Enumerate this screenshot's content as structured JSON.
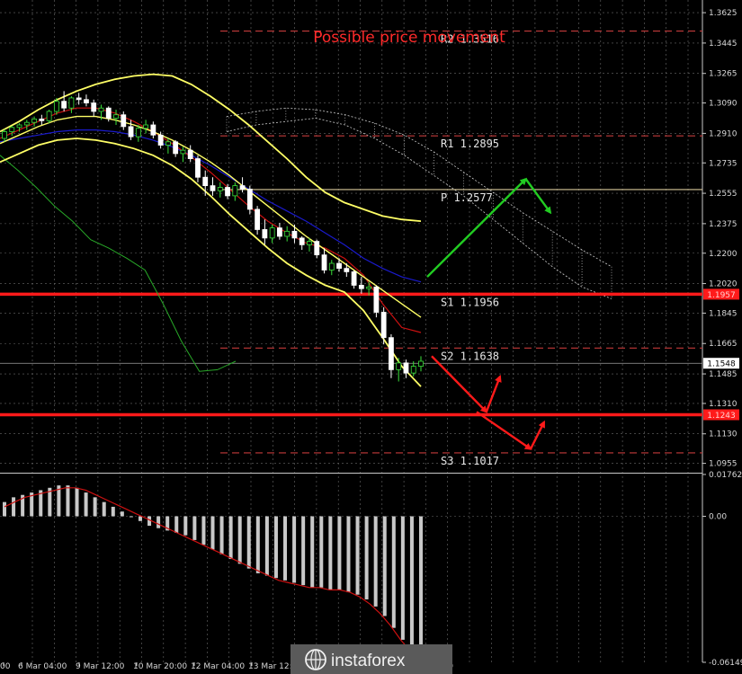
{
  "chart_data": {
    "type": "line",
    "title": "Possible price movement",
    "price_axis": {
      "ticks": [
        "1.3625",
        "1.3445",
        "1.3265",
        "1.3090",
        "1.2910",
        "1.2735",
        "1.2555",
        "1.2375",
        "1.2200",
        "1.2020",
        "1.1845",
        "1.1665",
        "1.1485",
        "1.1310",
        "1.1130",
        "1.0955"
      ],
      "range": [
        1.0905,
        1.37
      ]
    },
    "macd_axis": {
      "ticks": [
        "0.01762",
        "0.00",
        "-0.06149"
      ],
      "range": [
        -0.0615,
        0.0176
      ]
    },
    "time_axis": {
      "ticks": [
        "00",
        "6 Mar 04:00",
        "9 Mar 12:00",
        "10 Mar 20:00",
        "12 Mar 04:00",
        "13 Mar 12:",
        "12:00"
      ]
    },
    "levels": [
      {
        "name": "R2",
        "label": "R2  1.3516",
        "value": 1.3516,
        "color": "#c33a3a",
        "style": "dashed"
      },
      {
        "name": "R1",
        "label": "R1  1.2895",
        "value": 1.2895,
        "color": "#c33a3a",
        "style": "dashed"
      },
      {
        "name": "P",
        "label": "P  1.2577",
        "value": 1.2577,
        "color": "#d8c89a",
        "style": "solid"
      },
      {
        "name": "S1",
        "label": "S1  1.1956",
        "value": 1.1956,
        "color": "#c33a3a",
        "style": "dashed"
      },
      {
        "name": "S2",
        "label": "S2  1.1638",
        "value": 1.1638,
        "color": "#c33a3a",
        "style": "dashed"
      },
      {
        "name": "S3",
        "label": "S3  1.1017",
        "value": 1.1017,
        "color": "#c33a3a",
        "style": "dashed"
      }
    ],
    "support_resistance": [
      {
        "label": "1.1957",
        "value": 1.1957,
        "color": "#ff1a1a"
      },
      {
        "label": "1.1243",
        "value": 1.1243,
        "color": "#ff1a1a"
      }
    ],
    "current_price": {
      "label": "1.1548",
      "value": 1.1548
    },
    "candles": [
      [
        1.288,
        1.2935,
        1.286,
        1.292
      ],
      [
        1.292,
        1.2955,
        1.2895,
        1.2945
      ],
      [
        1.2945,
        1.297,
        1.292,
        1.296
      ],
      [
        1.296,
        1.299,
        1.293,
        1.2975
      ],
      [
        1.2975,
        1.301,
        1.295,
        1.2995
      ],
      [
        1.2995,
        1.302,
        1.296,
        1.2985
      ],
      [
        1.2985,
        1.305,
        1.297,
        1.304
      ],
      [
        1.304,
        1.312,
        1.302,
        1.31
      ],
      [
        1.31,
        1.316,
        1.304,
        1.306
      ],
      [
        1.306,
        1.313,
        1.303,
        1.312
      ],
      [
        1.312,
        1.315,
        1.308,
        1.311
      ],
      [
        1.311,
        1.314,
        1.307,
        1.309
      ],
      [
        1.309,
        1.311,
        1.301,
        1.304
      ],
      [
        1.304,
        1.308,
        1.299,
        1.306
      ],
      [
        1.306,
        1.307,
        1.298,
        1.3
      ],
      [
        1.3,
        1.305,
        1.296,
        1.302
      ],
      [
        1.302,
        1.304,
        1.293,
        1.295
      ],
      [
        1.295,
        1.299,
        1.287,
        1.289
      ],
      [
        1.289,
        1.296,
        1.286,
        1.294
      ],
      [
        1.294,
        1.299,
        1.291,
        1.296
      ],
      [
        1.296,
        1.298,
        1.288,
        1.29
      ],
      [
        1.29,
        1.292,
        1.282,
        1.284
      ],
      [
        1.284,
        1.288,
        1.279,
        1.286
      ],
      [
        1.286,
        1.287,
        1.277,
        1.279
      ],
      [
        1.279,
        1.283,
        1.274,
        1.281
      ],
      [
        1.281,
        1.284,
        1.274,
        1.276
      ],
      [
        1.276,
        1.278,
        1.262,
        1.265
      ],
      [
        1.265,
        1.269,
        1.254,
        1.26
      ],
      [
        1.26,
        1.265,
        1.254,
        1.257
      ],
      [
        1.257,
        1.262,
        1.253,
        1.259
      ],
      [
        1.259,
        1.261,
        1.252,
        1.254
      ],
      [
        1.254,
        1.262,
        1.251,
        1.26
      ],
      [
        1.26,
        1.265,
        1.256,
        1.258
      ],
      [
        1.258,
        1.26,
        1.243,
        1.246
      ],
      [
        1.246,
        1.248,
        1.231,
        1.234
      ],
      [
        1.234,
        1.24,
        1.225,
        1.229
      ],
      [
        1.229,
        1.237,
        1.226,
        1.235
      ],
      [
        1.235,
        1.238,
        1.228,
        1.23
      ],
      [
        1.23,
        1.236,
        1.227,
        1.233
      ],
      [
        1.233,
        1.237,
        1.226,
        1.229
      ],
      [
        1.229,
        1.23,
        1.222,
        1.225
      ],
      [
        1.225,
        1.229,
        1.221,
        1.227
      ],
      [
        1.227,
        1.228,
        1.217,
        1.219
      ],
      [
        1.219,
        1.223,
        1.208,
        1.21
      ],
      [
        1.21,
        1.216,
        1.207,
        1.214
      ],
      [
        1.214,
        1.217,
        1.209,
        1.211
      ],
      [
        1.211,
        1.214,
        1.206,
        1.209
      ],
      [
        1.209,
        1.21,
        1.199,
        1.201
      ],
      [
        1.201,
        1.206,
        1.196,
        1.199
      ],
      [
        1.199,
        1.203,
        1.195,
        1.2
      ],
      [
        1.2,
        1.201,
        1.182,
        1.185
      ],
      [
        1.185,
        1.188,
        1.166,
        1.17
      ],
      [
        1.17,
        1.172,
        1.146,
        1.151
      ],
      [
        1.151,
        1.158,
        1.144,
        1.155
      ],
      [
        1.155,
        1.157,
        1.146,
        1.149
      ],
      [
        1.149,
        1.156,
        1.147,
        1.153
      ],
      [
        1.153,
        1.159,
        1.15,
        1.156
      ]
    ],
    "indicators": {
      "bb_upper": [
        1.292,
        1.298,
        1.305,
        1.311,
        1.316,
        1.32,
        1.323,
        1.325,
        1.326,
        1.325,
        1.32,
        1.313,
        1.305,
        1.296,
        1.286,
        1.276,
        1.265,
        1.256,
        1.25,
        1.246,
        1.242,
        1.24,
        1.239
      ],
      "bb_lower": [
        1.274,
        1.279,
        1.284,
        1.287,
        1.288,
        1.287,
        1.285,
        1.282,
        1.278,
        1.272,
        1.264,
        1.254,
        1.243,
        1.233,
        1.223,
        1.214,
        1.207,
        1.201,
        1.197,
        1.186,
        1.17,
        1.153,
        1.141
      ],
      "ma_yellow": [
        1.285,
        1.29,
        1.295,
        1.299,
        1.301,
        1.301,
        1.299,
        1.296,
        1.292,
        1.287,
        1.281,
        1.274,
        1.266,
        1.257,
        1.248,
        1.239,
        1.23,
        1.222,
        1.214,
        1.206,
        1.198,
        1.19,
        1.182
      ],
      "ma_red": [
        1.288,
        1.293,
        1.298,
        1.303,
        1.306,
        1.306,
        1.303,
        1.298,
        1.292,
        1.285,
        1.277,
        1.268,
        1.258,
        1.248,
        1.239,
        1.232,
        1.226,
        1.223,
        1.217,
        1.207,
        1.19,
        1.176,
        1.173
      ],
      "ma_blue": [
        1.286,
        1.288,
        1.29,
        1.292,
        1.293,
        1.293,
        1.292,
        1.29,
        1.287,
        1.283,
        1.278,
        1.272,
        1.265,
        1.258,
        1.251,
        1.245,
        1.239,
        1.232,
        1.225,
        1.217,
        1.211,
        1.206,
        1.203
      ],
      "chikou": [
        1.278,
        1.269,
        1.259,
        1.248,
        1.239,
        1.228,
        1.223,
        1.217,
        1.21,
        1.19,
        1.168,
        1.15,
        1.151,
        1.156
      ],
      "cloud_a": [
        1.301,
        1.304,
        1.306,
        1.305,
        1.302,
        1.297,
        1.29,
        1.28,
        1.268,
        1.256,
        1.244,
        1.233,
        1.222,
        1.212
      ],
      "cloud_b": [
        1.292,
        1.296,
        1.298,
        1.3,
        1.296,
        1.288,
        1.278,
        1.266,
        1.254,
        1.24,
        1.226,
        1.212,
        1.2,
        1.193
      ],
      "macd_hist": [
        0.006,
        0.008,
        0.009,
        0.01,
        0.011,
        0.012,
        0.013,
        0.013,
        0.012,
        0.01,
        0.008,
        0.006,
        0.004,
        0.002,
        0.0,
        -0.002,
        -0.004,
        -0.005,
        -0.006,
        -0.007,
        -0.008,
        -0.01,
        -0.012,
        -0.014,
        -0.016,
        -0.018,
        -0.02,
        -0.022,
        -0.024,
        -0.025,
        -0.026,
        -0.027,
        -0.028,
        -0.029,
        -0.03,
        -0.03,
        -0.031,
        -0.031,
        -0.032,
        -0.033,
        -0.035,
        -0.038,
        -0.042,
        -0.047,
        -0.052,
        -0.057,
        -0.06
      ],
      "macd_signal": [
        0.004,
        0.006,
        0.008,
        0.009,
        0.01,
        0.011,
        0.012,
        0.012,
        0.011,
        0.009,
        0.007,
        0.005,
        0.003,
        0.001,
        -0.001,
        -0.003,
        -0.005,
        -0.007,
        -0.009,
        -0.011,
        -0.013,
        -0.015,
        -0.017,
        -0.019,
        -0.021,
        -0.023,
        -0.025,
        -0.027,
        -0.028,
        -0.029,
        -0.03,
        -0.03,
        -0.031,
        -0.031,
        -0.032,
        -0.034,
        -0.037,
        -0.041,
        -0.046,
        -0.052,
        -0.057,
        -0.06
      ]
    },
    "forecast_up": [
      [
        1.206,
        0
      ],
      [
        1.264,
        1
      ],
      [
        1.244,
        2
      ]
    ],
    "forecast_down_1": [
      [
        1.159,
        0
      ],
      [
        1.126,
        1
      ],
      [
        1.147,
        2
      ]
    ],
    "forecast_down_2": [
      [
        1.126,
        0
      ],
      [
        1.104,
        1
      ],
      [
        1.12,
        2
      ]
    ],
    "colors": {
      "bull": "#3ae03a",
      "bear": "#ffffff",
      "bb": "#ffff66",
      "ma_red": "#cc1111",
      "ma_blue": "#1a1acc",
      "chikou": "#28a828",
      "macd_bar": "#c8c8c8",
      "macd_signal": "#cc1111",
      "arrow_up": "#22cc22",
      "arrow_down": "#ff1a1a",
      "cloud": "#cccccc"
    },
    "grid": true
  },
  "watermark": {
    "brand": "instaforex"
  }
}
